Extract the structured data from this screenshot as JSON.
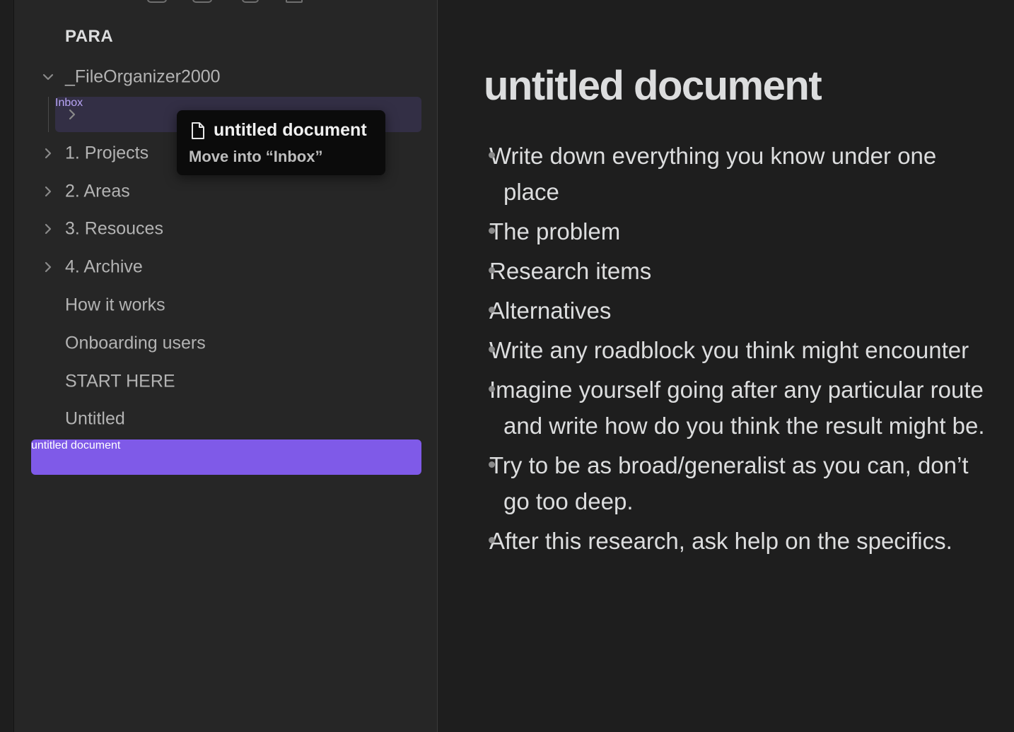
{
  "sidebar": {
    "vault_title": "PARA",
    "root_folder": "_FileOrganizer2000",
    "inbox": "Inbox",
    "folders": [
      "1. Projects",
      "2. Areas",
      "3. Resouces",
      "4. Archive"
    ],
    "files": [
      "How it works",
      "Onboarding users",
      "START HERE",
      "Untitled"
    ],
    "active_file": "untitled document"
  },
  "tooltip": {
    "title": "untitled document",
    "subtitle": "Move into “Inbox”"
  },
  "editor": {
    "title": "untitled document",
    "bullets": [
      "Write down everything you know under one place",
      "The problem",
      "Research items",
      "Alternatives",
      "Write any roadblock you think might encounter",
      "Imagine yourself going after any particular route and write how do you think the result might be.",
      "Try to be as broad/generalist as you can, don’t go too deep.",
      "After this research, ask help on the specifics."
    ]
  },
  "colors": {
    "accent": "#7f5ae8",
    "inbox_text": "#b9a6f7",
    "sidebar_bg": "#262626",
    "editor_bg": "#1e1e1e"
  }
}
